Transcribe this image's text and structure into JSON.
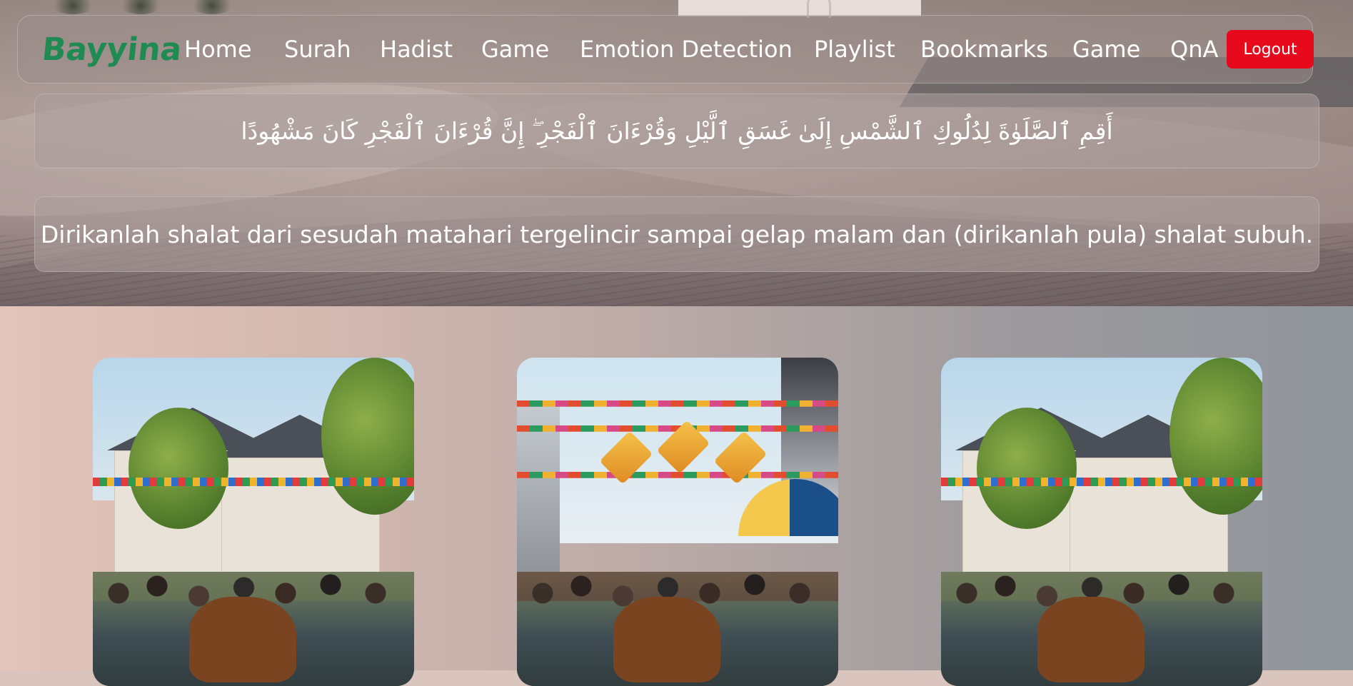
{
  "brand": "Bayyina",
  "nav": {
    "items": [
      {
        "label": "Home"
      },
      {
        "label": "Surah"
      },
      {
        "label": "Hadist"
      },
      {
        "label": "Game"
      },
      {
        "label": "Emotion Detection"
      },
      {
        "label": "Playlist"
      },
      {
        "label": "Bookmarks"
      },
      {
        "label": "Game"
      },
      {
        "label": "QnA"
      }
    ],
    "logout_label": "Logout"
  },
  "verse": {
    "arabic": "أَقِمِ ٱلصَّلَوٰةَ لِدُلُوكِ ٱلشَّمْسِ إِلَىٰ غَسَقِ ٱلَّيْلِ وَقُرْءَانَ ٱلْفَجْرِ ۖ إِنَّ قُرْءَانَ ٱلْفَجْرِ كَانَ مَشْهُودًا",
    "translation": "Dirikanlah shalat dari sesudah matahari tergelincir sampai gelap malam dan (dirikanlah pula) shalat subuh."
  },
  "cards": [
    {
      "scene": "eid-cattle-crowd"
    },
    {
      "scene": "eid-market-street"
    },
    {
      "scene": "eid-cattle-crowd"
    }
  ],
  "colors": {
    "brand_green": "#1f8a52",
    "logout_red": "#e60a1c",
    "nav_text": "#ffffff"
  },
  "icons": []
}
